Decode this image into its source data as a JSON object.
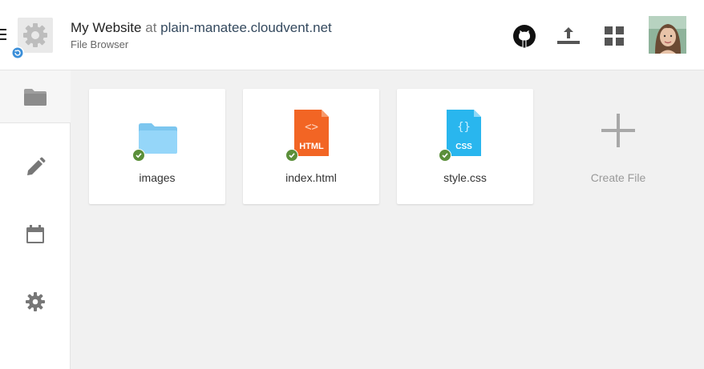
{
  "header": {
    "site_name": "My Website",
    "at": "at",
    "domain": "plain-manatee.cloudvent.net",
    "subtitle": "File Browser"
  },
  "icons": {
    "menu": "hamburger-menu-icon",
    "logo": "gear-logo-icon",
    "sync": "sync-icon",
    "github": "github-icon",
    "upload": "upload-icon",
    "apps": "grid-icon",
    "avatar": "user-avatar"
  },
  "sidebar": {
    "items": [
      {
        "name": "files",
        "icon": "folder-icon",
        "active": true
      },
      {
        "name": "editor",
        "icon": "pencil-icon",
        "active": false
      },
      {
        "name": "schedule",
        "icon": "calendar-icon",
        "active": false
      },
      {
        "name": "settings",
        "icon": "gear-icon",
        "active": false
      }
    ]
  },
  "files": [
    {
      "label": "images",
      "type": "folder",
      "status": "synced"
    },
    {
      "label": "index.html",
      "type": "html",
      "badge": "HTML",
      "glyph": "<>",
      "status": "synced"
    },
    {
      "label": "style.css",
      "type": "css",
      "badge": "CSS",
      "glyph": "{}",
      "status": "synced"
    }
  ],
  "create_file": {
    "label": "Create File"
  },
  "colors": {
    "accent_blue": "#3b8fd9",
    "folder": "#8fd1f6",
    "html": "#f26524",
    "css": "#29b6ee",
    "check": "#5b8f3a"
  }
}
